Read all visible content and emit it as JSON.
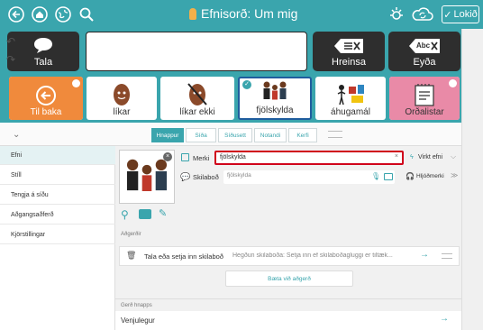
{
  "topbar": {
    "title": "Efnisorð: Um mig",
    "lock_label": "Lokið",
    "color": "#3aa5ad"
  },
  "message_bar": {
    "speak_label": "Tala",
    "clear_label": "Hreinsa",
    "delete_label": "Eyða",
    "delete_glyph_text": "Abc"
  },
  "buttons": [
    {
      "label": "Til baka",
      "color": "#f08a3c"
    },
    {
      "label": "líkar"
    },
    {
      "label": "líkar ekki"
    },
    {
      "label": "fjölskylda",
      "selected": true
    },
    {
      "label": "áhugamál"
    },
    {
      "label": "Orðalistar",
      "color": "#e98aa7"
    }
  ],
  "tabs": [
    "Hnappur",
    "Síða",
    "Síðusett",
    "Notandi",
    "Kerfi"
  ],
  "active_tab": "Hnappur",
  "sidebar": {
    "items": [
      "Efni",
      "Stíll",
      "Tengja á síðu",
      "Aðgangsaðferð",
      "Kjörstillingar"
    ],
    "active": "Efni"
  },
  "editor": {
    "label_label": "Merki",
    "label_value": "fjölskylda",
    "message_label": "Skilaboð",
    "message_value": "fjölskylda",
    "virkt_efni": "Virkt efni",
    "sound_label": "Hljóðmerki",
    "actions_header": "Aðgerðir",
    "action_title": "Tala eða setja inn skilaboð",
    "action_desc": "Hegðun skilaboða: Setja inn ef skilaboðagluggi er tiltæk...",
    "add_action": "Bæta við aðgerð",
    "button_type_header": "Gerð hnapps",
    "button_type_value": "Venjulegur"
  }
}
